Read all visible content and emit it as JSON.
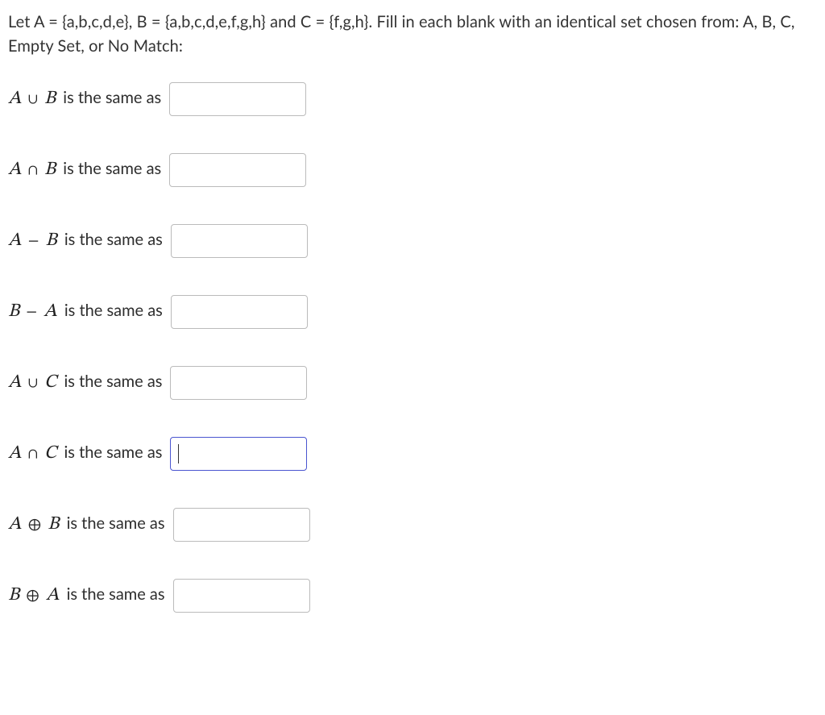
{
  "instructions": "Let A = {a,b,c,d,e}, B = {a,b,c,d,e,f,g,h} and C = {f,g,h}. Fill in each blank with an identical set chosen from: A, B, C, Empty Set, or No Match:",
  "same_as_text": " is the same as",
  "questions": [
    {
      "left": "A",
      "op": "∪",
      "right": "B",
      "value": "",
      "focused": false
    },
    {
      "left": "A",
      "op": "∩",
      "right": "B",
      "value": "",
      "focused": false
    },
    {
      "left": "A",
      "op": "−",
      "right": "B",
      "value": "",
      "focused": false
    },
    {
      "left": "B",
      "op": "−",
      "right": "A",
      "value": "",
      "focused": false
    },
    {
      "left": "A",
      "op": "∪",
      "right": "C",
      "value": "",
      "focused": false
    },
    {
      "left": "A",
      "op": "∩",
      "right": "C",
      "value": "",
      "focused": true
    },
    {
      "left": "A",
      "op": "⊕",
      "right": "B",
      "value": "",
      "focused": false
    },
    {
      "left": "B",
      "op": "⊕",
      "right": "A",
      "value": "",
      "focused": false
    }
  ]
}
